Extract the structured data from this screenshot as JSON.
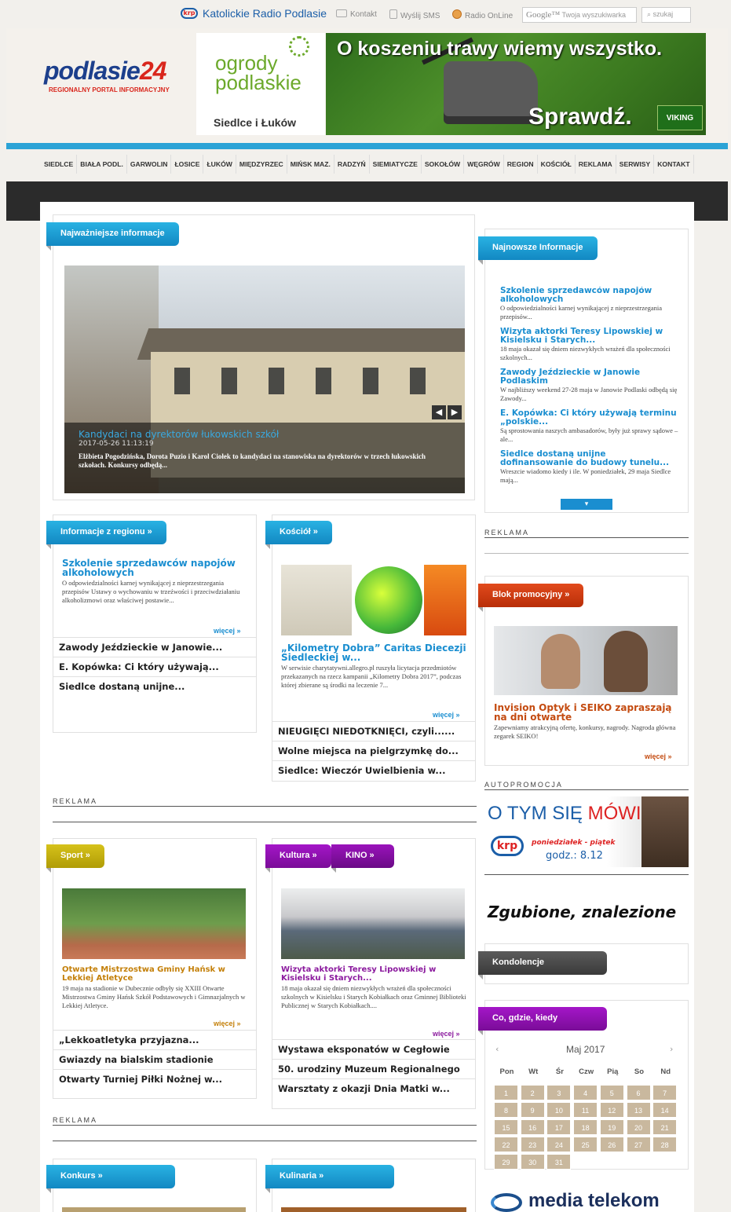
{
  "topbar": {
    "radio_logo": "krp",
    "radio_title": "Katolickie Radio Podlasie",
    "links": [
      "Kontakt",
      "Wyślij SMS",
      "Radio OnLine"
    ],
    "search_brand": "Google™",
    "search_placeholder": "Twoja wyszukiwarka",
    "search_button": "szukaj"
  },
  "header": {
    "logo_main_a": "podlasie",
    "logo_main_b": "24",
    "logo_sub": "REGIONALNY PORTAL INFORMACYJNY",
    "ogrody_line1": "ogrody",
    "ogrody_line2": "podlaskie",
    "ogrody_city": "Siedlce i Łuków",
    "banner_headline": "O koszeniu trawy wiemy wszystko.",
    "banner_cta": "Sprawdź.",
    "banner_brand": "VIKING"
  },
  "nav": [
    "SIEDLCE",
    "BIAŁA PODL.",
    "GARWOLIN",
    "ŁOSICE",
    "ŁUKÓW",
    "MIĘDZYRZEC",
    "MIŃSK MAZ.",
    "RADZYŃ",
    "SIEMIATYCZE",
    "SOKOŁÓW",
    "WĘGRÓW",
    "REGION",
    "KOŚCIÓŁ",
    "REKLAMA",
    "SERWISY",
    "KONTAKT"
  ],
  "main_news": {
    "tab": "Najważniejsze informacje",
    "slide_title": "Kandydaci na dyrektorów łukowskich szkół",
    "slide_date": "2017-05-26 11:13:19",
    "slide_text": "Elżbieta Pogodzińska, Dorota Puzio i Karol Ciołek to kandydaci na stanowiska na dyrektorów w trzech łukowskich szkołach. Konkursy odbędą...",
    "prev": "◀",
    "next": "▶"
  },
  "newest": {
    "tab": "Najnowsze Informacje",
    "items": [
      {
        "title": "Szkolenie sprzedawców napojów alkoholowych",
        "text": "O odpowiedzialności karnej wynikającej z nieprzestrzegania przepisów..."
      },
      {
        "title": "Wizyta aktorki Teresy Lipowskiej w Kisielsku i Starych...",
        "text": "18 maja okazał się dniem niezwykłych wrażeń dla społeczności szkolnych..."
      },
      {
        "title": "Zawody Jeździeckie w Janowie Podlaskim",
        "text": "W najbliższy weekend 27-28 maja w Janowie Podlaski odbędą się Zawody..."
      },
      {
        "title": "E. Kopówka: Ci który używają terminu „polskie...",
        "text": "Są sprostowania naszych ambasadorów, były już sprawy sądowe – ale..."
      },
      {
        "title": "Siedlce dostaną unijne dofinansowanie do budowy tunelu...",
        "text": "Wreszcie wiadomo kiedy i ile. W poniedziałek, 29 maja Siedlce mają..."
      }
    ],
    "down": "▾"
  },
  "reklama": "REKLAMA",
  "autopromocja": "AUTOPROMOCJA",
  "region": {
    "tab": "Informacje z regionu »",
    "lead_title": "Szkolenie sprzedawców napojów alkoholowych",
    "lead_text": "O odpowiedzialności karnej wynikającej z nieprzestrzegania przepisów Ustawy o wychowaniu w trzeźwości i przeciwdziałaniu alkoholizmowi oraz właściwej postawie...",
    "more": "więcej »",
    "links": [
      "Zawody Jeździeckie w Janowie...",
      "E. Kopówka: Ci który używają...",
      "Siedlce dostaną unijne..."
    ]
  },
  "church": {
    "tab": "Kościół »",
    "lead_title": "„Kilometry Dobra” Caritas Diecezji Siedleckiej w...",
    "lead_text": "W serwisie charytatywni.allegro.pl ruszyła licytacja przedmiotów przekazanych na rzecz kampanii „Kilometry Dobra 2017”, podczas której zbierane są środki na leczenie 7...",
    "more": "więcej »",
    "links": [
      "NIEUGIĘCI NIEDOTKNIĘCI, czyli......",
      "Wolne miejsca na pielgrzymkę do...",
      "Siedlce: Wieczór Uwielbienia w..."
    ]
  },
  "promo": {
    "tab": "Blok promocyjny »",
    "title": "Invision Optyk i SEIKO zapraszają na dni otwarte",
    "text": "Zapewniamy atrakcyjną ofertę, konkursy, nagrody. Nagroda główna zegarek SEIKO!",
    "more": "więcej »"
  },
  "otym": {
    "line_a": "O TYM SIĘ ",
    "line_b": "MÓWI",
    "logo": "krp",
    "days": "poniedziałek - piątek",
    "time": "godz.: 8.12"
  },
  "zgubione": "Zgubione, znalezione",
  "kondolencje": "Kondolencje",
  "sport": {
    "tab": "Sport »",
    "lead_title": "Otwarte Mistrzostwa Gminy Hańsk w Lekkiej Atletyce",
    "lead_text": "19 maja na stadionie w Dubecznie odbyły się XXIII Otwarte Mistrzostwa Gminy Hańsk Szkół Podstawowych i Gimnazjalnych w Lekkiej Atletyce.",
    "more": "więcej »",
    "links": [
      "„Lekkoatletyka przyjazna...",
      "Gwiazdy na bialskim stadionie",
      "Otwarty Turniej Piłki Nożnej w..."
    ]
  },
  "culture": {
    "tab": "Kultura »",
    "tab2": "KINO »",
    "lead_title": "Wizyta aktorki Teresy Lipowskiej w Kisielsku i Starych...",
    "lead_text": "18 maja okazał się dniem niezwykłych wrażeń dla społeczności szkolnych w Kisielsku i Starych Kobiałkach oraz Gminnej Biblioteki Publicznej w Starych Kobiałkach....",
    "more": "więcej »",
    "links": [
      "Wystawa eksponatów w Cegłowie",
      "50. urodziny Muzeum Regionalnego",
      "Warsztaty z okazji Dnia Matki w..."
    ]
  },
  "calendar": {
    "tab": "Co, gdzie, kiedy",
    "month": "Maj 2017",
    "prev": "‹",
    "next": "›",
    "headers": [
      "Pon",
      "Wt",
      "Śr",
      "Czw",
      "Pią",
      "So",
      "Nd"
    ],
    "days": [
      "1",
      "2",
      "3",
      "4",
      "5",
      "6",
      "7",
      "8",
      "9",
      "10",
      "11",
      "12",
      "13",
      "14",
      "15",
      "16",
      "17",
      "18",
      "19",
      "20",
      "21",
      "22",
      "23",
      "24",
      "25",
      "26",
      "27",
      "28",
      "29",
      "30",
      "31"
    ]
  },
  "konkurs_tab": "Konkurs »",
  "kulinaria_tab": "Kulinaria »",
  "media_telekom": "media telekom"
}
